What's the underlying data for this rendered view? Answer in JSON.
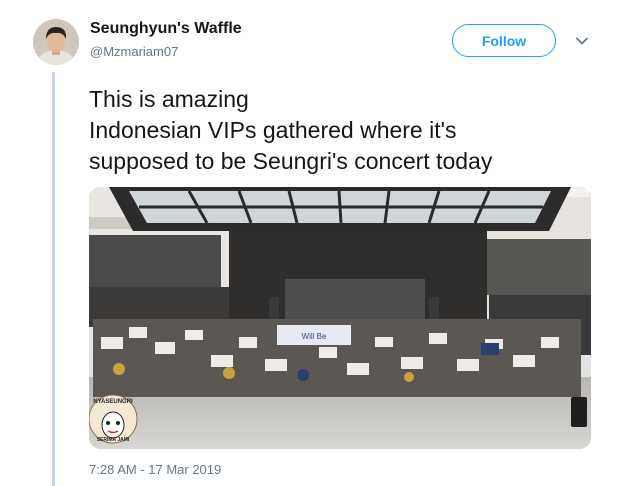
{
  "tweet": {
    "author_name": "Seunghyun's Waffle",
    "author_handle": "@Mzmariam07",
    "follow_label": "Follow",
    "text_lines": [
      "This is amazing",
      "Indonesian VIPs gathered where it's",
      "supposed to be Seungri's concert today"
    ],
    "timestamp": "7:28 AM - 17 Mar 2019",
    "photo_banner_text": "Will Be",
    "photo_watermark_top": "NYASEUNGRI",
    "photo_watermark_bottom": "SERIMA JAMI"
  },
  "colors": {
    "accent": "#1da1f2",
    "secondary_text": "#657786",
    "thread_line": "#c6d8e8"
  },
  "icons": {
    "menu": "chevron-down-icon"
  }
}
